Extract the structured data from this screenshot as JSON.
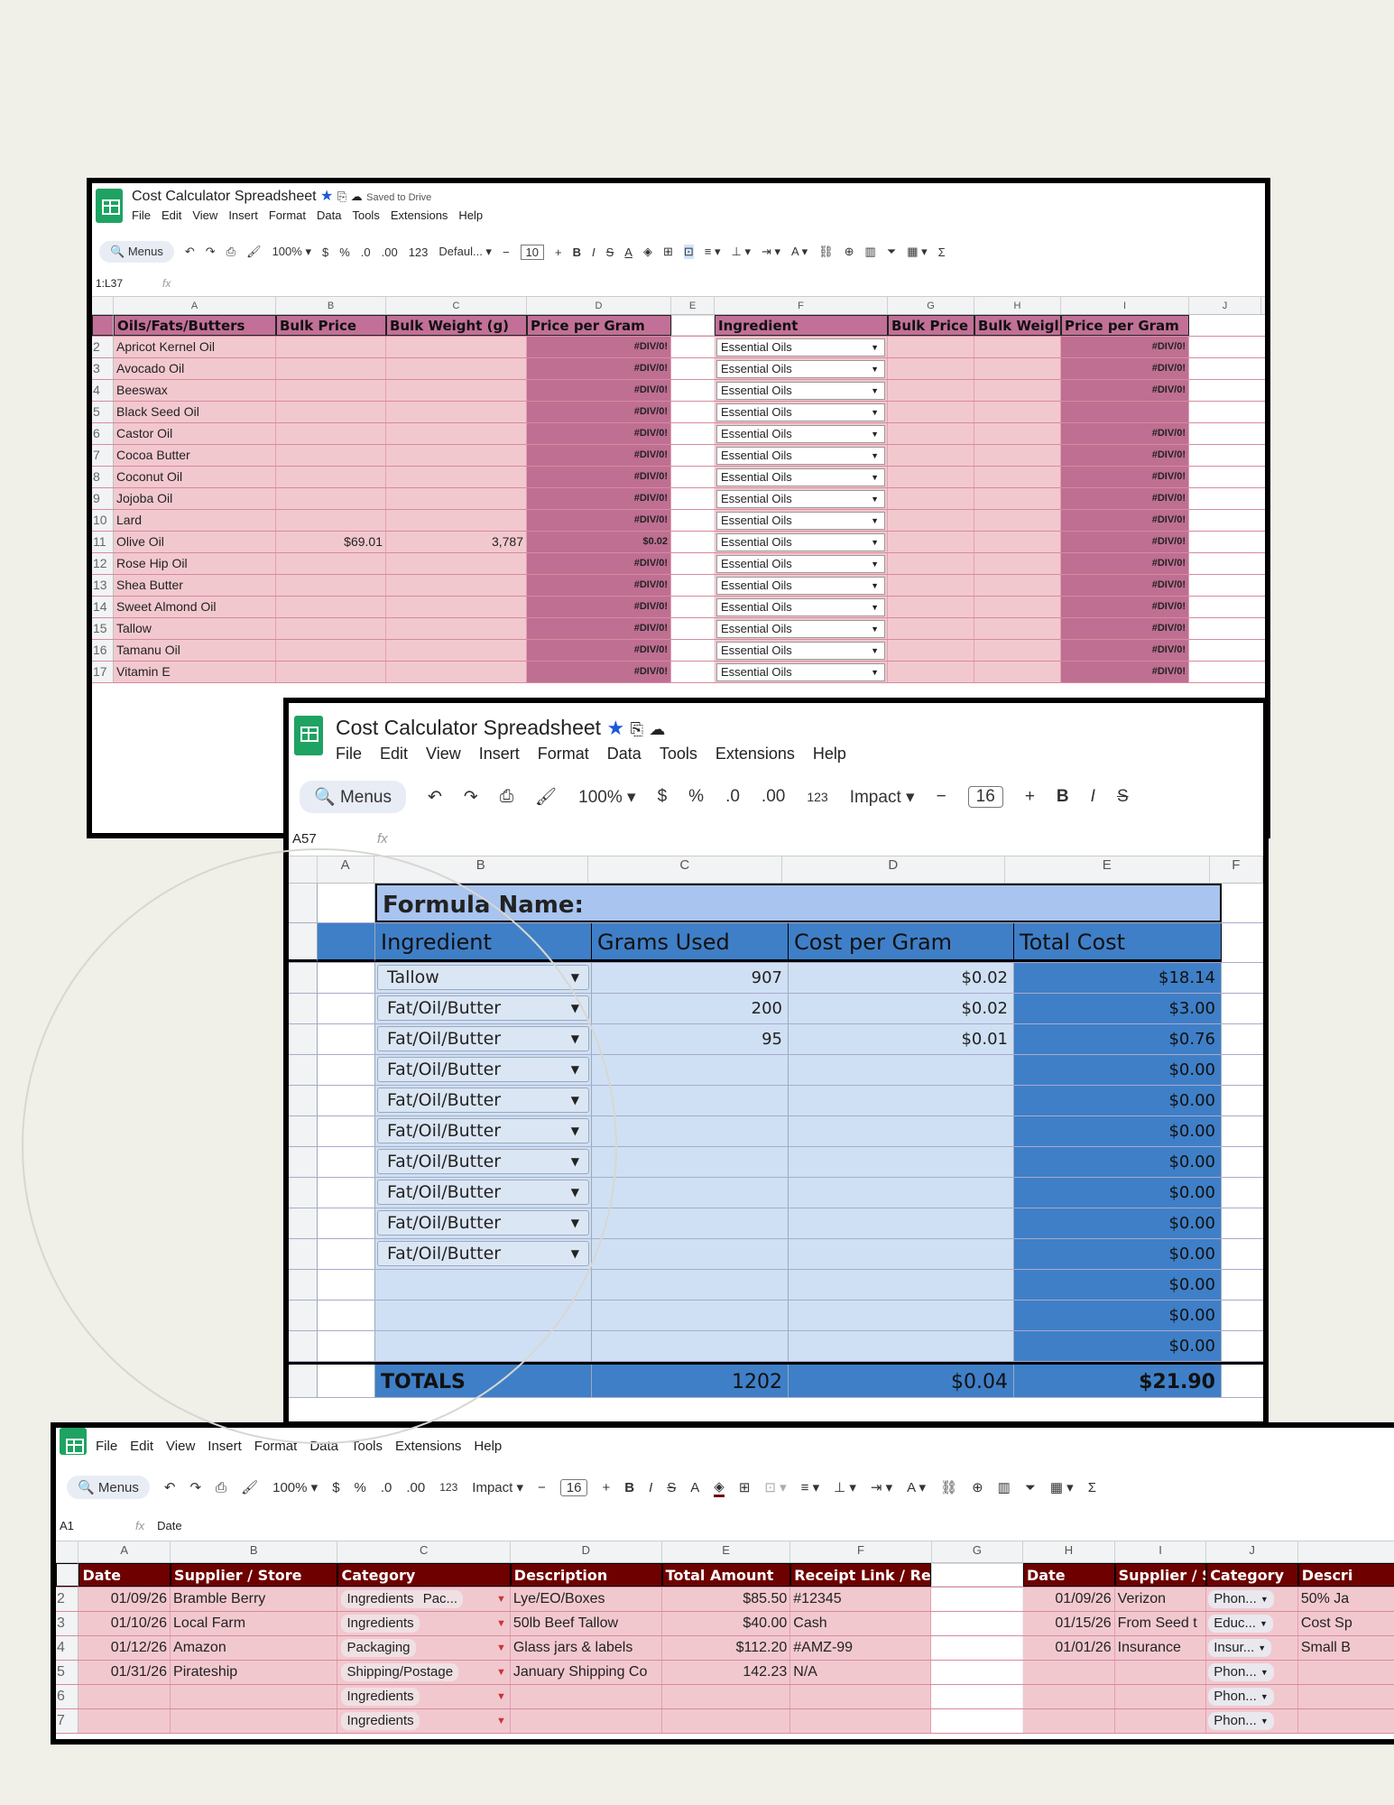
{
  "app": {
    "doc_title": "Cost Calculator Spreadsheet",
    "saved_status": "Saved to Drive",
    "menus": [
      "File",
      "Edit",
      "View",
      "Insert",
      "Format",
      "Data",
      "Tools",
      "Extensions",
      "Help"
    ],
    "search_label": "Menus",
    "zoom": "100%"
  },
  "sheet1": {
    "font": "Defaul...",
    "font_size": "10",
    "name_box": "1:L37",
    "col_letters": [
      "A",
      "B",
      "C",
      "D",
      "E",
      "F",
      "G",
      "H",
      "I",
      "J"
    ],
    "headers_left": [
      "Oils/Fats/Butters",
      "Bulk Price",
      "Bulk Weight (g)",
      "Price per Gram"
    ],
    "headers_right": [
      "Ingredient",
      "Bulk Price",
      "Bulk Weigl",
      "Price per Gram"
    ],
    "rows": [
      {
        "n": "2",
        "name": "Apricot Kernel Oil",
        "price": "",
        "weight": "",
        "ppg": "#DIV/0!",
        "right": "Essential Oils",
        "rppg": "#DIV/0!"
      },
      {
        "n": "3",
        "name": "Avocado Oil",
        "price": "",
        "weight": "",
        "ppg": "#DIV/0!",
        "right": "Essential Oils",
        "rppg": "#DIV/0!"
      },
      {
        "n": "4",
        "name": "Beeswax",
        "price": "",
        "weight": "",
        "ppg": "#DIV/0!",
        "right": "Essential Oils",
        "rppg": "#DIV/0!"
      },
      {
        "n": "5",
        "name": "Black Seed Oil",
        "price": "",
        "weight": "",
        "ppg": "#DIV/0!",
        "right": "Essential Oils",
        "rppg": ""
      },
      {
        "n": "6",
        "name": "Castor Oil",
        "price": "",
        "weight": "",
        "ppg": "#DIV/0!",
        "right": "Essential Oils",
        "rppg": "#DIV/0!"
      },
      {
        "n": "7",
        "name": "Cocoa Butter",
        "price": "",
        "weight": "",
        "ppg": "#DIV/0!",
        "right": "Essential Oils",
        "rppg": "#DIV/0!"
      },
      {
        "n": "8",
        "name": "Coconut Oil",
        "price": "",
        "weight": "",
        "ppg": "#DIV/0!",
        "right": "Essential Oils",
        "rppg": "#DIV/0!"
      },
      {
        "n": "9",
        "name": "Jojoba Oil",
        "price": "",
        "weight": "",
        "ppg": "#DIV/0!",
        "right": "Essential Oils",
        "rppg": "#DIV/0!"
      },
      {
        "n": "10",
        "name": "Lard",
        "price": "",
        "weight": "",
        "ppg": "#DIV/0!",
        "right": "Essential Oils",
        "rppg": "#DIV/0!"
      },
      {
        "n": "11",
        "name": "Olive Oil",
        "price": "$69.01",
        "weight": "3,787",
        "ppg": "$0.02",
        "right": "Essential Oils",
        "rppg": "#DIV/0!"
      },
      {
        "n": "12",
        "name": "Rose Hip Oil",
        "price": "",
        "weight": "",
        "ppg": "#DIV/0!",
        "right": "Essential Oils",
        "rppg": "#DIV/0!"
      },
      {
        "n": "13",
        "name": "Shea Butter",
        "price": "",
        "weight": "",
        "ppg": "#DIV/0!",
        "right": "Essential Oils",
        "rppg": "#DIV/0!"
      },
      {
        "n": "14",
        "name": "Sweet Almond Oil",
        "price": "",
        "weight": "",
        "ppg": "#DIV/0!",
        "right": "Essential Oils",
        "rppg": "#DIV/0!"
      },
      {
        "n": "15",
        "name": "Tallow",
        "price": "",
        "weight": "",
        "ppg": "#DIV/0!",
        "right": "Essential Oils",
        "rppg": "#DIV/0!"
      },
      {
        "n": "16",
        "name": "Tamanu Oil",
        "price": "",
        "weight": "",
        "ppg": "#DIV/0!",
        "right": "Essential Oils",
        "rppg": "#DIV/0!"
      },
      {
        "n": "17",
        "name": "Vitamin E",
        "price": "",
        "weight": "",
        "ppg": "#DIV/0!",
        "right": "Essential Oils",
        "rppg": "#DIV/0!"
      }
    ]
  },
  "sheet2": {
    "font": "Impact",
    "font_size": "16",
    "name_box": "A57",
    "col_letters": [
      "A",
      "B",
      "C",
      "D",
      "E",
      "F"
    ],
    "formula_name_label": "Formula Name:",
    "headers": [
      "Ingredient",
      "Grams Used",
      "Cost per Gram",
      "Total Cost"
    ],
    "rows": [
      {
        "ing": "Tallow",
        "grams": "907",
        "cpg": "$0.02",
        "total": "$18.14"
      },
      {
        "ing": "Fat/Oil/Butter",
        "grams": "200",
        "cpg": "$0.02",
        "total": "$3.00"
      },
      {
        "ing": "Fat/Oil/Butter",
        "grams": "95",
        "cpg": "$0.01",
        "total": "$0.76"
      },
      {
        "ing": "Fat/Oil/Butter",
        "grams": "",
        "cpg": "",
        "total": "$0.00"
      },
      {
        "ing": "Fat/Oil/Butter",
        "grams": "",
        "cpg": "",
        "total": "$0.00"
      },
      {
        "ing": "Fat/Oil/Butter",
        "grams": "",
        "cpg": "",
        "total": "$0.00"
      },
      {
        "ing": "Fat/Oil/Butter",
        "grams": "",
        "cpg": "",
        "total": "$0.00"
      },
      {
        "ing": "Fat/Oil/Butter",
        "grams": "",
        "cpg": "",
        "total": "$0.00"
      },
      {
        "ing": "Fat/Oil/Butter",
        "grams": "",
        "cpg": "",
        "total": "$0.00"
      },
      {
        "ing": "Fat/Oil/Butter",
        "grams": "",
        "cpg": "",
        "total": "$0.00"
      },
      {
        "ing": "",
        "grams": "",
        "cpg": "",
        "total": "$0.00"
      },
      {
        "ing": "",
        "grams": "",
        "cpg": "",
        "total": "$0.00"
      },
      {
        "ing": "",
        "grams": "",
        "cpg": "",
        "total": "$0.00"
      }
    ],
    "totals": {
      "label": "TOTALS",
      "grams": "1202",
      "cpg": "$0.04",
      "total": "$21.90"
    }
  },
  "sheet3": {
    "font": "Impact",
    "font_size": "16",
    "name_box": "A1",
    "formula_value": "Date",
    "col_letters": [
      "A",
      "B",
      "C",
      "D",
      "E",
      "F",
      "G",
      "H",
      "I",
      "J"
    ],
    "headers_left": [
      "Date",
      "Supplier / Store",
      "Category",
      "Description",
      "Total Amount",
      "Receipt Link / Ref"
    ],
    "headers_right": [
      "Date",
      "Supplier / S",
      "Category",
      "Descri"
    ],
    "rows": [
      {
        "n": "2",
        "date": "01/09/26",
        "sup": "Bramble Berry",
        "cat": "Ingredients",
        "cat2": "Pac...",
        "desc": "Lye/EO/Boxes",
        "amt": "$85.50",
        "ref": "#12345",
        "rdate": "01/09/26",
        "rsup": "Verizon",
        "rcat": "Phon...",
        "rdesc": "50% Ja"
      },
      {
        "n": "3",
        "date": "01/10/26",
        "sup": "Local Farm",
        "cat": "Ingredients",
        "cat2": "",
        "desc": "50lb Beef Tallow",
        "amt": "$40.00",
        "ref": "Cash",
        "rdate": "01/15/26",
        "rsup": "From Seed t",
        "rcat": "Educ...",
        "rdesc": "Cost Sp"
      },
      {
        "n": "4",
        "date": "01/12/26",
        "sup": "Amazon",
        "cat": "Packaging",
        "cat2": "",
        "desc": "Glass jars & labels",
        "amt": "$112.20",
        "ref": "#AMZ-99",
        "rdate": "01/01/26",
        "rsup": "Insurance",
        "rcat": "Insur...",
        "rdesc": "Small B"
      },
      {
        "n": "5",
        "date": "01/31/26",
        "sup": "Pirateship",
        "cat": "Shipping/Postage",
        "cat2": "",
        "desc": "January Shipping Co",
        "amt": "142.23",
        "ref": "N/A",
        "rdate": "",
        "rsup": "",
        "rcat": "Phon...",
        "rdesc": ""
      },
      {
        "n": "6",
        "date": "",
        "sup": "",
        "cat": "Ingredients",
        "cat2": "",
        "desc": "",
        "amt": "",
        "ref": "",
        "rdate": "",
        "rsup": "",
        "rcat": "Phon...",
        "rdesc": ""
      },
      {
        "n": "7",
        "date": "",
        "sup": "",
        "cat": "Ingredients",
        "cat2": "",
        "desc": "",
        "amt": "",
        "ref": "",
        "rdate": "",
        "rsup": "",
        "rcat": "Phon...",
        "rdesc": ""
      }
    ]
  }
}
